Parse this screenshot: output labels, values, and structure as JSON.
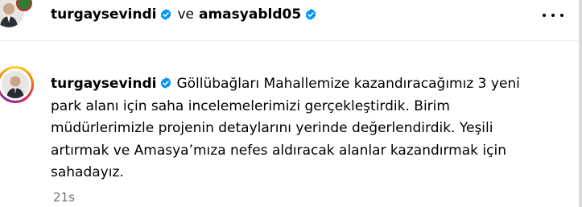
{
  "header": {
    "username": "turgaysevindi",
    "joiner": "ve",
    "collaborator": "amasyabld05",
    "more_icon": "more-horizontal-icon"
  },
  "comment": {
    "username": "turgaysevindi",
    "text": "Göllübağları Mahallemize kazandıracağımız 3 yeni park alanı için saha incelemelerimizi gerçekleştirdik. Birim müdürlerimizle projenin detaylarını yerinde değerlendirdik. Yeşili artırmak ve Amasya’mıza nefes aldıracak alanlar kazandırmak için sahadayız.",
    "timestamp": "21s"
  },
  "colors": {
    "verified": "#0095f6",
    "secondary_text": "#737373",
    "story_ring": [
      "#fdd835",
      "#f57c00",
      "#d81b60",
      "#8e24aa"
    ]
  }
}
